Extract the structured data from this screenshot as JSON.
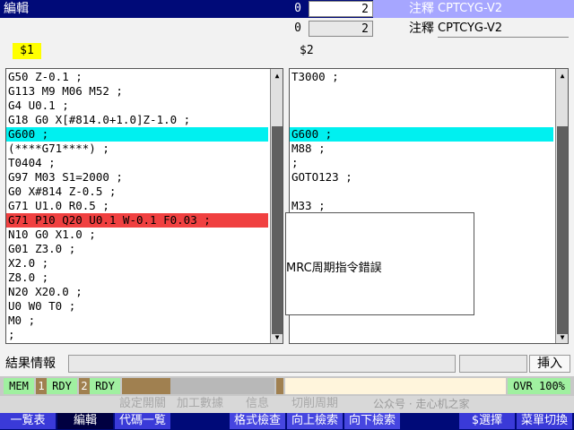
{
  "header": {
    "mode": "編輯",
    "value1_left": "0",
    "value1_right": "2",
    "comment_label": "注釋",
    "comment_value": "CPTCYG-V2",
    "value2_left": "0",
    "value2_right": "2",
    "comment_label2": "注釋",
    "comment_value2": "CPTCYG-V2"
  },
  "system1_label": "$1",
  "system2_label": "$2",
  "left_program": [
    "G50 Z-0.1 ;",
    "G113 M9 M06 M52 ;",
    "G4 U0.1 ;",
    "G18 G0 X[#814.0+1.0]Z-1.0 ;",
    "G600 ;",
    "(****G71****) ;",
    "T0404 ;",
    "G97 M03 S1=2000 ;",
    "G0 X#814 Z-0.5 ;",
    "G71 U1.0 R0.5 ;",
    "G71 P10 Q20 U0.1 W-0.1 F0.03 ;",
    "N10 G0 X1.0 ;",
    "G01 Z3.0 ;",
    "X2.0 ;",
    "Z8.0 ;",
    "N20 X20.0 ;",
    "U0 W0 T0 ;",
    "M0 ;",
    ";"
  ],
  "right_program": [
    "T3000 ;",
    "",
    "",
    "",
    "G600 ;",
    "M88 ;",
    ";",
    "GOTO123 ;",
    "",
    "M33 ;"
  ],
  "error_dialog": {
    "message": "MRC周期指令錯誤"
  },
  "result_label": "結果情報",
  "insert_label": "挿入",
  "status": {
    "mem": "MEM",
    "sys1_num": "1",
    "sys1_state": "RDY",
    "sys2_num": "2",
    "sys2_state": "RDY",
    "ovr": "OVR 100%"
  },
  "softkeys_upper": [
    "設定開關",
    "加工數據",
    "信息",
    "切削周期"
  ],
  "watermark": "公众号 · 走心机之家",
  "softkeys": [
    "一覧表",
    "編輯",
    "代碼一覧",
    "",
    "格式檢查",
    "向上檢索",
    "向下檢索",
    "",
    "$選擇",
    "菜單切換"
  ],
  "colors": {
    "title_bg": "#000a78",
    "highlight": "#00f0f0",
    "error_line": "#f04040",
    "softkey_bg": "#000a78",
    "status_green": "#a0f0a0"
  }
}
